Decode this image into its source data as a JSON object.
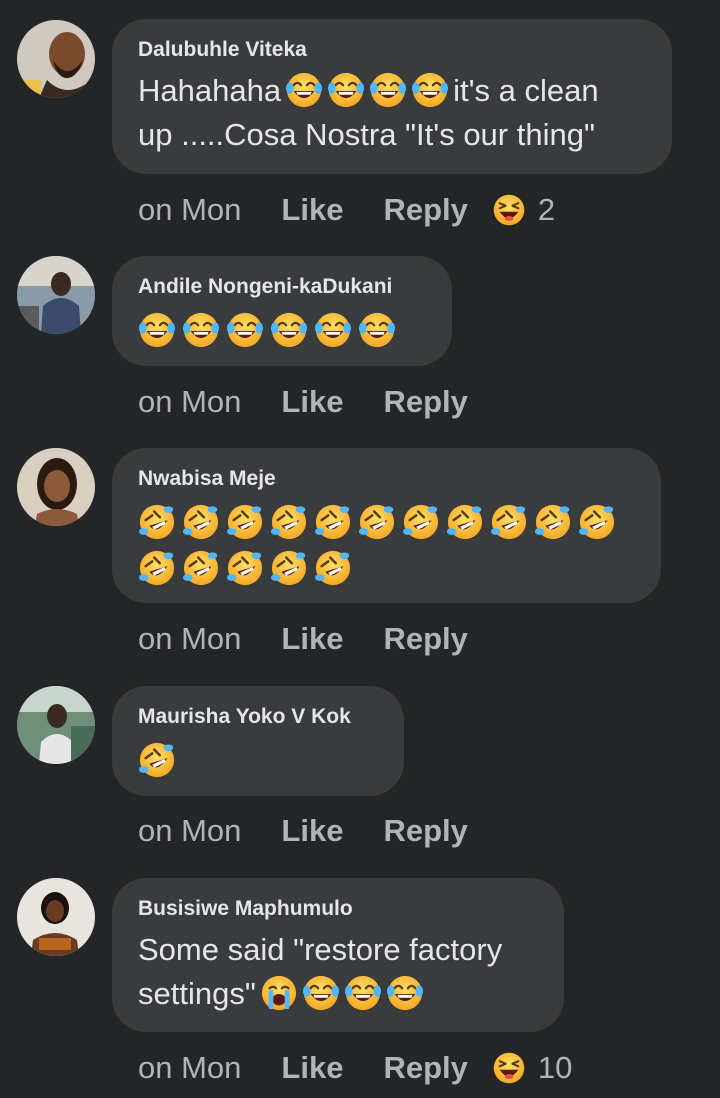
{
  "comments": [
    {
      "author": "Dalubuhle Viteka",
      "text_before": "Hahahaha",
      "text_after": "it's a clean",
      "text_line2": "up .....Cosa Nostra \"It's our thing\"",
      "time": "on Mon",
      "like": "Like",
      "reply": "Reply",
      "reaction_count": "2",
      "reaction_icon": "laughing-reaction-icon"
    },
    {
      "author": "Andile Nongeni-kaDukani",
      "time": "on Mon",
      "like": "Like",
      "reply": "Reply"
    },
    {
      "author": "Nwabisa Meje",
      "time": "on Mon",
      "like": "Like",
      "reply": "Reply"
    },
    {
      "author": "Maurisha Yoko V Kok",
      "time": "on Mon",
      "like": "Like",
      "reply": "Reply"
    },
    {
      "author": "Busisiwe Maphumulo",
      "text_line1": "Some said \"restore factory",
      "text_line2": "settings\"",
      "time": "on Mon",
      "like": "Like",
      "reply": "Reply",
      "reaction_count": "10",
      "reaction_icon": "laughing-reaction-icon"
    }
  ],
  "colors": {
    "background": "#242526",
    "bubble": "#3a3b3c",
    "text": "#e4e6eb",
    "secondary_text": "#b0b3b8",
    "emoji_yellow": "#ffcc33"
  },
  "icons": [
    "tears-of-joy-emoji",
    "rolling-laughing-emoji",
    "crying-emoji",
    "laughing-reaction-icon"
  ]
}
